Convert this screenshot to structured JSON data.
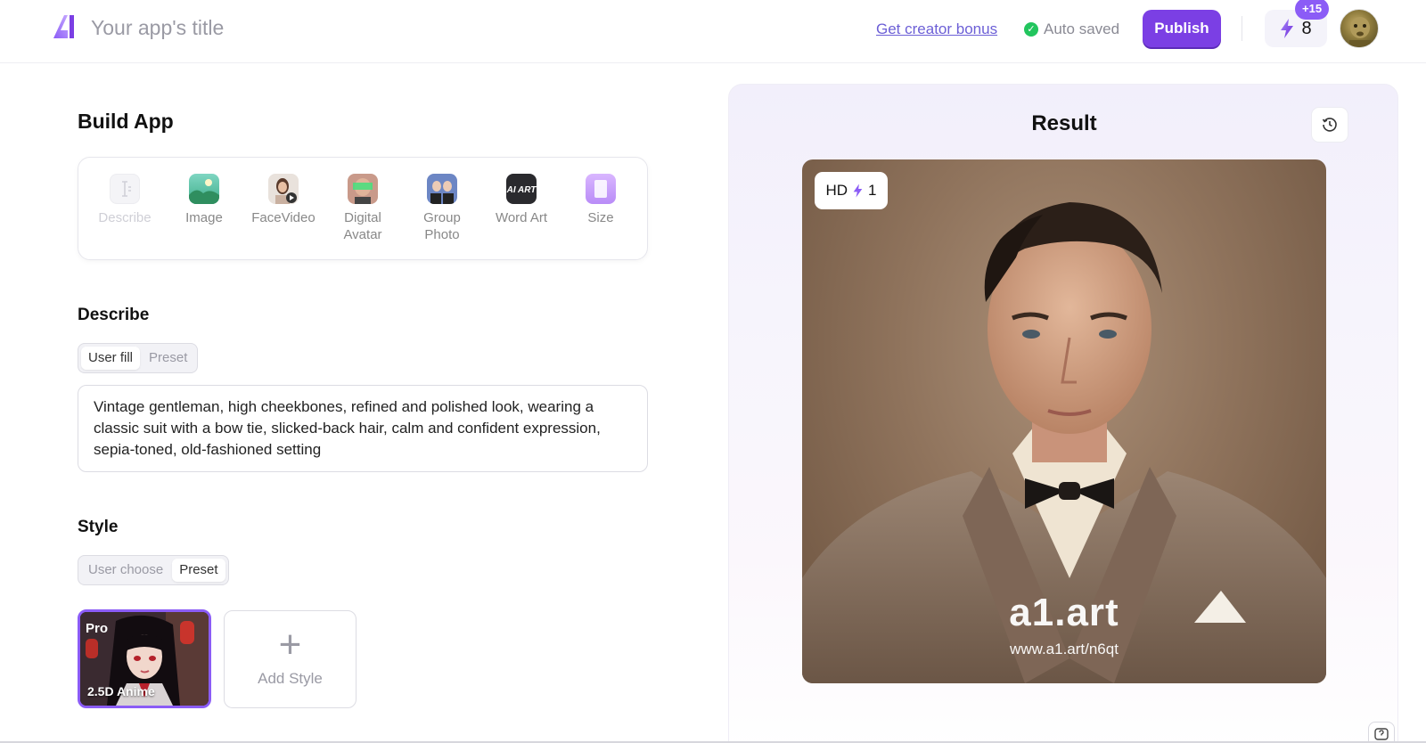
{
  "header": {
    "app_title": "Your app's title",
    "creator_bonus": "Get creator bonus",
    "autosave": "Auto saved",
    "publish": "Publish",
    "credits": "8",
    "credits_badge": "+15"
  },
  "build": {
    "title": "Build App",
    "tools": [
      {
        "label": "Describe",
        "icon": "text-cursor-icon"
      },
      {
        "label": "Image",
        "icon": "landscape-icon"
      },
      {
        "label": "FaceVideo",
        "icon": "face-video-icon"
      },
      {
        "label": "Digital Avatar",
        "icon": "digital-avatar-icon"
      },
      {
        "label": "Group Photo",
        "icon": "group-photo-icon"
      },
      {
        "label": "Word Art",
        "icon": "word-art-icon",
        "icon_text": "AI ART"
      },
      {
        "label": "Size",
        "icon": "size-icon"
      }
    ]
  },
  "describe": {
    "title": "Describe",
    "options": [
      "User fill",
      "Preset"
    ],
    "active": "User fill",
    "prompt": "Vintage gentleman, high cheekbones, refined and polished look, wearing a classic suit with a bow tie, slicked-back hair, calm and confident expression, sepia-toned, old-fashioned setting"
  },
  "style": {
    "title": "Style",
    "options": [
      "User choose",
      "Preset"
    ],
    "active": "Preset",
    "selected": {
      "badge": "Pro",
      "label": "2.5D Anime"
    },
    "add_label": "Add Style"
  },
  "result": {
    "title": "Result",
    "hd_label": "HD",
    "hd_cost": "1",
    "watermark_main": "a1.art",
    "watermark_url": "www.a1.art/n6qt"
  },
  "colors": {
    "accent": "#7b3fe4",
    "link": "#6c5fd6",
    "success": "#22c55e"
  }
}
